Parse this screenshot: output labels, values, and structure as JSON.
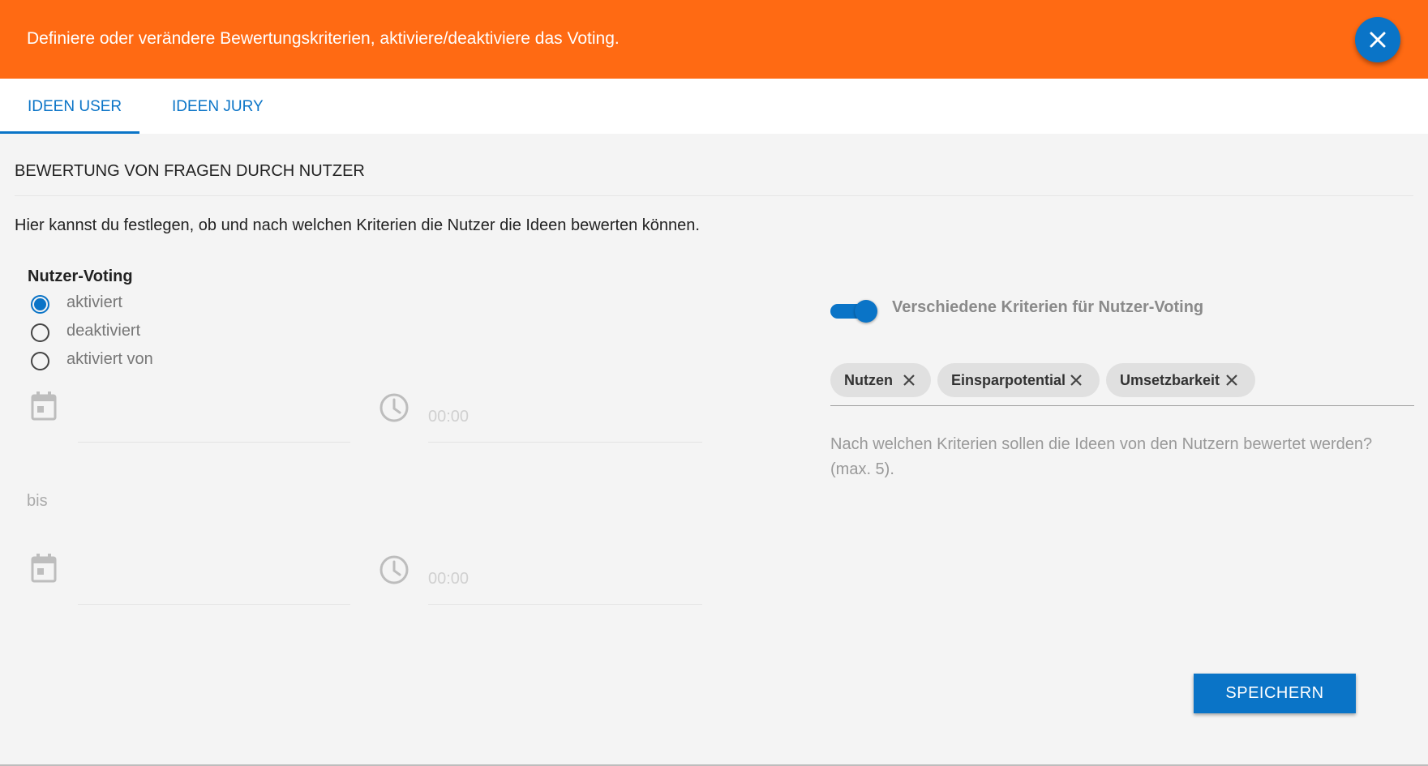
{
  "banner": {
    "text": "Definiere oder verändere Bewertungskriterien, aktiviere/deaktiviere das Voting."
  },
  "tabs": [
    {
      "label": "IDEEN USER",
      "active": true
    },
    {
      "label": "IDEEN JURY",
      "active": false
    }
  ],
  "section": {
    "title": "BEWERTUNG VON FRAGEN DURCH NUTZER",
    "description": "Hier kannst du festlegen, ob und nach welchen Kriterien die Nutzer die Ideen bewerten können."
  },
  "voting": {
    "label": "Nutzer-Voting",
    "options": [
      {
        "label": "aktiviert",
        "checked": true
      },
      {
        "label": "deaktiviert",
        "checked": false
      },
      {
        "label": "aktiviert von",
        "checked": false
      }
    ],
    "from": {
      "date": "",
      "time": "00:00"
    },
    "separator": "bis",
    "to": {
      "date": "",
      "time": "00:00"
    }
  },
  "criteria": {
    "toggle_label": "Verschiedene Kriterien für Nutzer-Voting",
    "toggle_on": true,
    "chips": [
      "Nutzen",
      "Einsparpotential",
      "Umsetzbarkeit"
    ],
    "hint": "Nach welchen Kriterien sollen die Ideen von den Nutzern bewertet werden? (max. 5)."
  },
  "actions": {
    "save_label": "SPEICHERN"
  },
  "colors": {
    "banner": "#ff6a13",
    "accent": "#0a74c7",
    "background": "#f4f4f4"
  },
  "icons": [
    "close-icon",
    "calendar-icon",
    "clock-icon",
    "chip-remove-icon"
  ]
}
